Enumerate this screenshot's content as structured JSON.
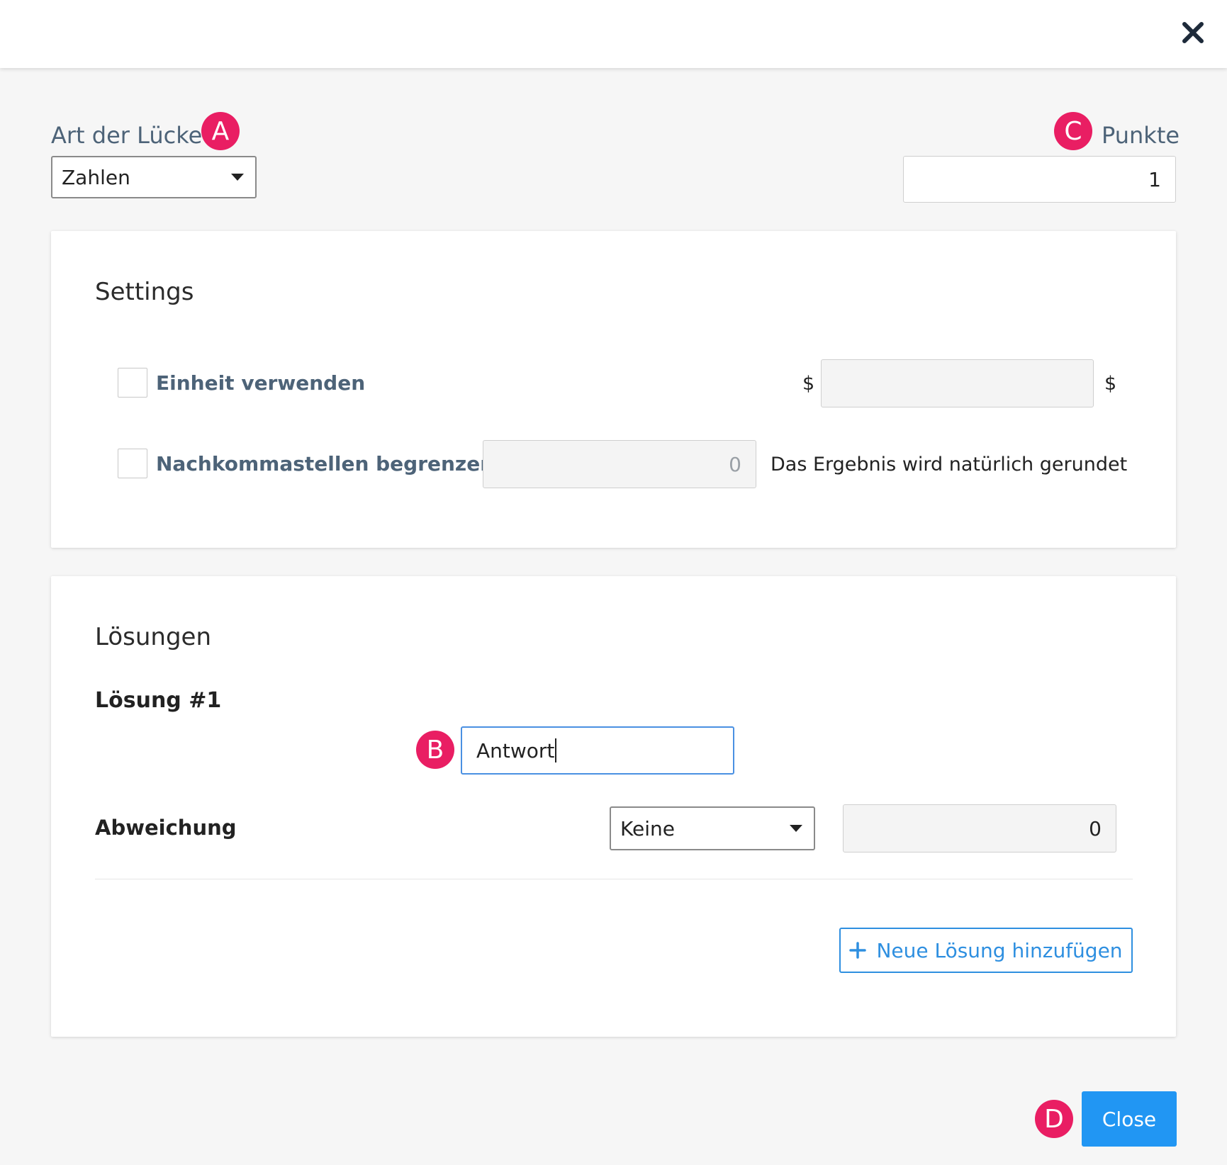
{
  "header": {
    "close_icon": "close-icon"
  },
  "gap_type": {
    "label": "Art der Lücke",
    "selected": "Zahlen"
  },
  "points": {
    "label": "Punkte",
    "value": "1"
  },
  "settings": {
    "title": "Settings",
    "use_unit": {
      "label": "Einheit verwenden",
      "prefix": "$",
      "suffix": "$",
      "value": ""
    },
    "limit_decimals": {
      "label": "Nachkommastellen begrenzen",
      "value": "0",
      "note": "Das Ergebnis wird natürlich gerundet"
    }
  },
  "solutions": {
    "title": "Lösungen",
    "items": [
      {
        "title": "Lösung #1",
        "answer": "Antwort",
        "deviation_label": "Abweichung",
        "deviation_selected": "Keine",
        "deviation_value": "0"
      }
    ],
    "add_label": "Neue Lösung hinzufügen"
  },
  "footer": {
    "close_label": "Close"
  },
  "badges": {
    "a": "A",
    "b": "B",
    "c": "C",
    "d": "D"
  },
  "colors": {
    "badge": "#e91e63",
    "primary": "#2196f3",
    "label": "#4d6378",
    "focus": "#4a90e2"
  }
}
